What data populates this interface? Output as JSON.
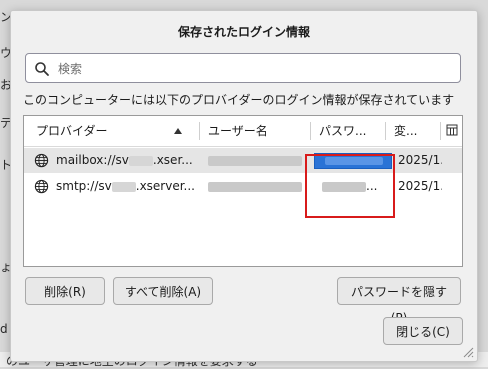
{
  "background": {
    "fragments": [
      "ン",
      "ウ",
      "お",
      "テ",
      "ト",
      "ょ",
      "d"
    ],
    "bottom_text": "のユーザ管理に地主のログイン情報を要求する"
  },
  "dialog": {
    "title": "保存されたログイン情報",
    "search": {
      "placeholder": "検索",
      "value": ""
    },
    "description": "このコンピューターには以下のプロバイダーのログイン情報が保存されています",
    "table": {
      "columns": [
        "プロバイダー",
        "ユーザー名",
        "パスワ...",
        "変..."
      ],
      "rows": [
        {
          "provider_prefix": "mailbox://sv",
          "provider_suffix": ".xser...",
          "changed": "2025/1..."
        },
        {
          "provider_prefix": "smtp://sv",
          "provider_suffix": ".xserver...",
          "password_masked": "...",
          "changed": "2025/1..."
        }
      ]
    },
    "buttons": {
      "delete": "削除(R)",
      "delete_all": "すべて削除(A)",
      "hide_passwords": "パスワードを隠す(P)",
      "close": "閉じる(C)"
    }
  },
  "colors": {
    "selection": "#2a73d6",
    "highlight": "#d81b1b"
  },
  "icons": [
    "search-icon",
    "globe-icon",
    "column-picker-icon",
    "sort-ascending-icon",
    "resize-grip-icon"
  ]
}
